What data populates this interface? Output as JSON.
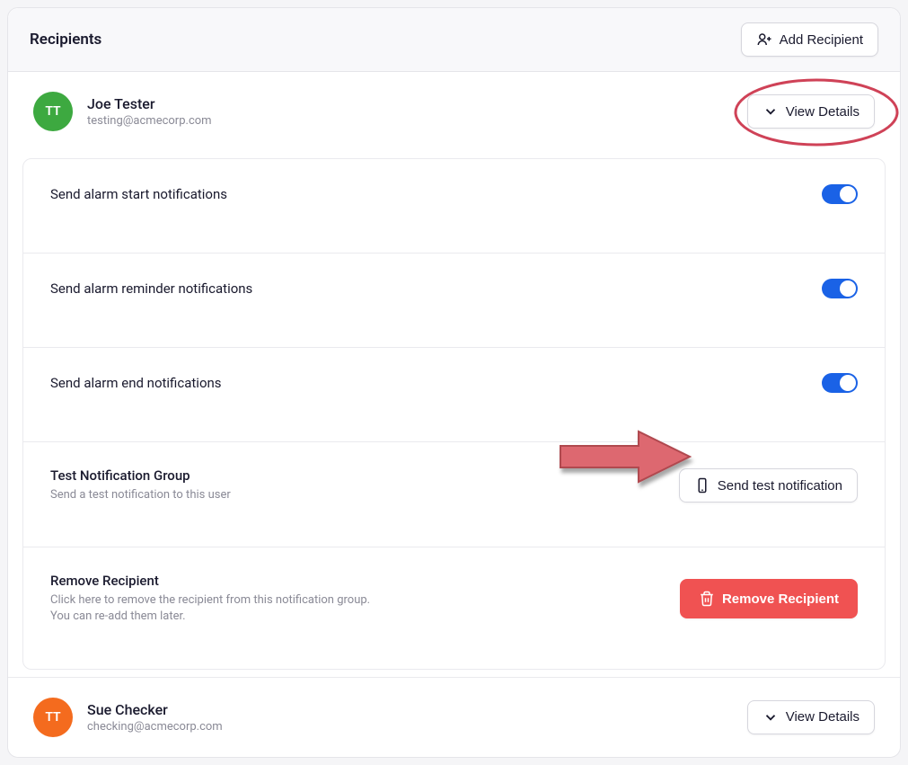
{
  "header": {
    "title": "Recipients",
    "add_label": "Add Recipient"
  },
  "view_details_label": "View Details",
  "recipients": [
    {
      "avatar_initials": "TT",
      "name": "Joe Tester",
      "email": "testing@acmecorp.com",
      "avatar_color": "green"
    },
    {
      "avatar_initials": "TT",
      "name": "Sue Checker",
      "email": "checking@acmecorp.com",
      "avatar_color": "orange"
    }
  ],
  "toggles": {
    "start": "Send alarm start notifications",
    "reminder": "Send alarm reminder notifications",
    "end": "Send alarm end notifications"
  },
  "test_section": {
    "title": "Test Notification Group",
    "subtitle": "Send a test notification to this user",
    "button": "Send test notification"
  },
  "remove_section": {
    "title": "Remove Recipient",
    "subtitle": "Click here to remove the recipient from this notification group.\nYou can re-add them later.",
    "button": "Remove Recipient"
  }
}
